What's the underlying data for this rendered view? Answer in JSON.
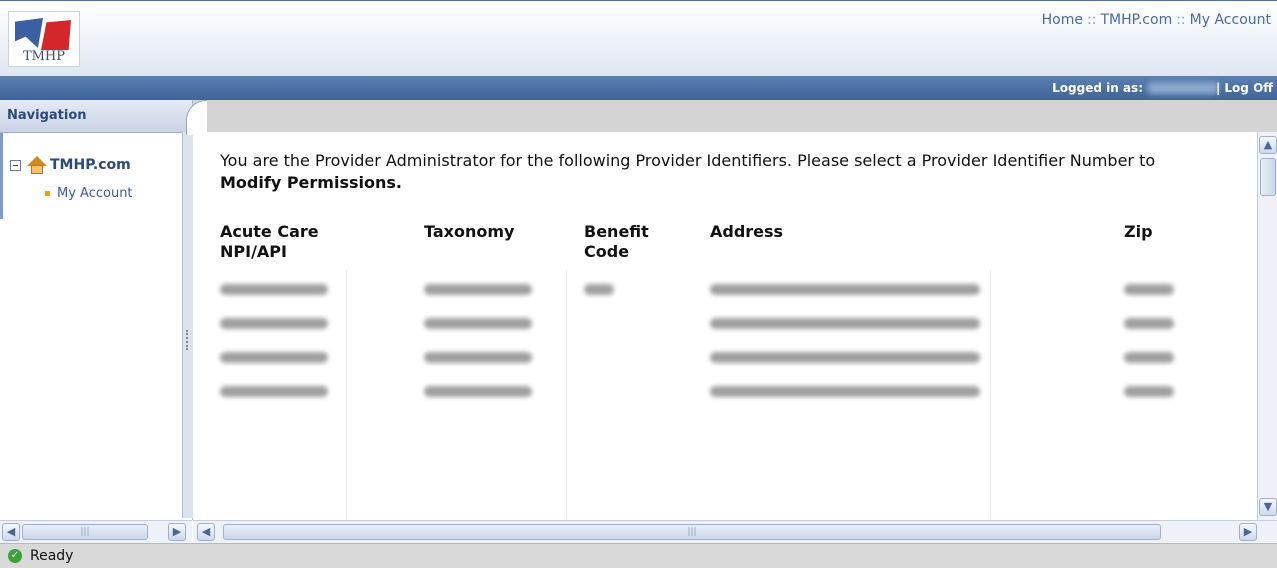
{
  "header": {
    "logo_text": "TMHP",
    "links": [
      "Home",
      "TMHP.com",
      "My Account"
    ],
    "separator": "::"
  },
  "userbar": {
    "logged_in_label": "Logged in as:",
    "separator": "|",
    "logoff_label": "Log Off"
  },
  "nav": {
    "title": "Navigation",
    "root_label": "TMHP.com",
    "child_label": "My Account"
  },
  "main": {
    "intro_text": "You are the Provider Administrator for the following Provider Identifiers. Please select a Provider Identifier Number to ",
    "intro_bold": "Modify Permissions."
  },
  "table": {
    "columns": {
      "npi_line1": "Acute Care",
      "npi_line2": "NPI/API",
      "taxonomy": "Taxonomy",
      "benefit_line1": "Benefit",
      "benefit_line2": "Code",
      "address": "Address",
      "zip": "Zip"
    },
    "row_count": 4
  },
  "statusbar": {
    "text": "Ready"
  },
  "icons": {
    "expander": "collapse-icon",
    "home": "house-icon",
    "status": "checkmark-icon"
  },
  "colors": {
    "brand_blue": "#3f6498",
    "link_blue": "#4a6aa6",
    "brand_red": "#d3272c",
    "status_green": "#39a33a"
  }
}
